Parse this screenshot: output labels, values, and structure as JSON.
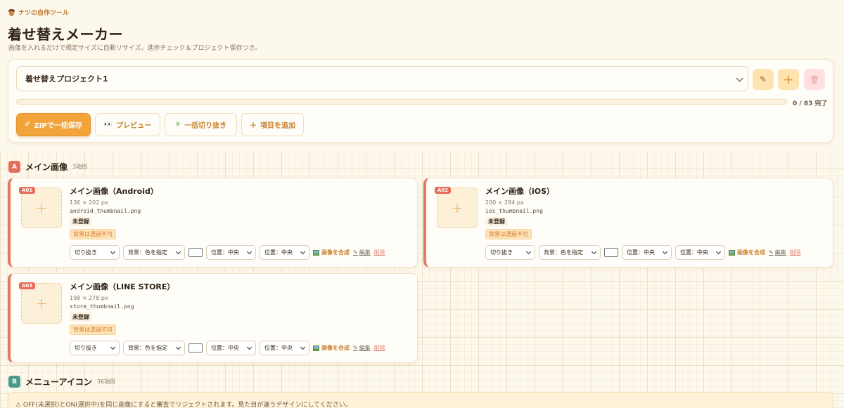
{
  "brand": {
    "name": "ナツの自作ツール",
    "icon": "acorn-icon"
  },
  "page": {
    "title": "着せ替えメーカー",
    "subtitle": "画像を入れるだけで規定サイズに自動リサイズ。進捗チェック＆プロジェクト保存つき。"
  },
  "project": {
    "selected": "着せ替えプロジェクト1",
    "progress_text": "0 / 83 完了",
    "progress_fraction": 0,
    "edit_icon": "✎",
    "add_icon": "＋",
    "delete_icon": "🗑"
  },
  "actions": {
    "zip": {
      "icon": "✐",
      "label": "ZIPで一括保存"
    },
    "preview": {
      "icon": "👀",
      "label": "プレビュー"
    },
    "crop": {
      "icon": "✳",
      "label": "一括切り抜き"
    },
    "add_item": {
      "icon": "＋",
      "label": "項目を追加"
    }
  },
  "sections": [
    {
      "badge": "A",
      "title": "メイン画像",
      "count": "3項目",
      "color": "#e66d5a"
    },
    {
      "badge": "B",
      "title": "メニューアイコン",
      "count": "36項目",
      "color": "#4a9a8a"
    }
  ],
  "controls": {
    "crop": "切り抜き",
    "bg": "背景：色を指定",
    "pos_h": "位置：中央",
    "pos_v": "位置：中央",
    "compose": "画像を合成",
    "edit": "編集",
    "delete": "削除",
    "plus": "+"
  },
  "items": [
    {
      "id": "A01",
      "name": "メイン画像（Android）",
      "size": "136 × 202 px",
      "file": "android_thumbnail.png",
      "status": "未登録",
      "warning": "背景は透過不可"
    },
    {
      "id": "A02",
      "name": "メイン画像（iOS）",
      "size": "200 × 284 px",
      "file": "ios_thumbnail.png",
      "status": "未登録",
      "warning": "背景は透過不可"
    },
    {
      "id": "A03",
      "name": "メイン画像（LINE STORE）",
      "size": "198 × 278 px",
      "file": "store_thumbnail.png",
      "status": "未登録",
      "warning": "背景は透過不可"
    }
  ],
  "notice": "⚠ OFF(未選択)とON(選択中)を同じ画像にすると審査でリジェクトされます。見た目が違うデザインにしてください。"
}
